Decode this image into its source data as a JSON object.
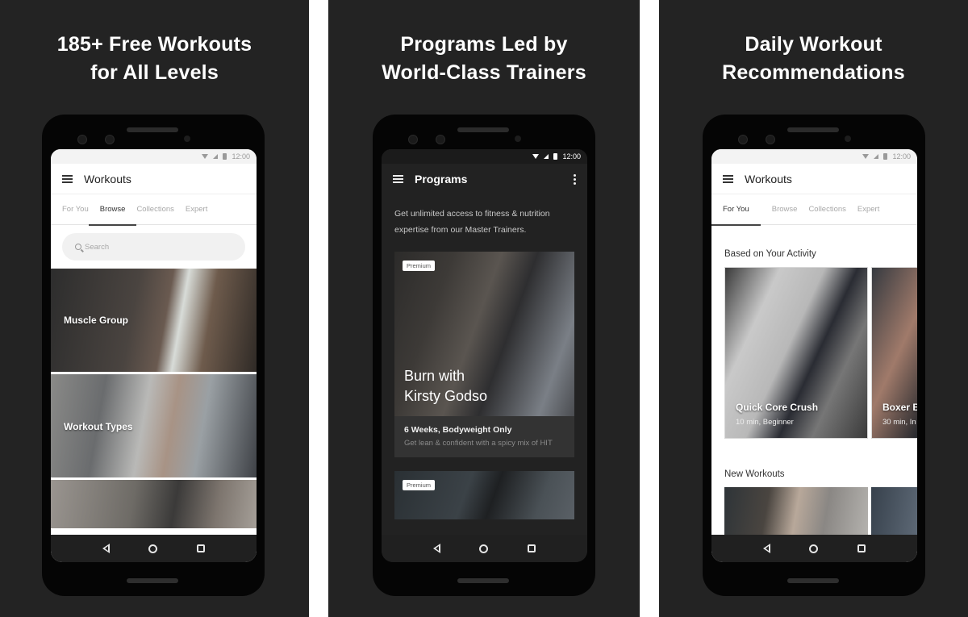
{
  "panels": [
    {
      "headline": [
        "185+ Free Workouts",
        "for All Levels"
      ],
      "status_time": "12:00",
      "appbar_title": "Workouts",
      "tabs": [
        "For You",
        "Browse",
        "Collections",
        "Expert"
      ],
      "active_tab": "Browse",
      "search_placeholder": "Search",
      "categories": [
        "Muscle Group",
        "Workout Types",
        ""
      ]
    },
    {
      "headline": [
        "Programs Led by",
        "World-Class Trainers"
      ],
      "status_time": "12:00",
      "appbar_title": "Programs",
      "intro": "Get unlimited access to fitness & nutrition expertise from our Master Trainers.",
      "programs": [
        {
          "badge": "Premium",
          "title": [
            "Burn with",
            "Kirsty Godso"
          ],
          "subtitle": "6 Weeks, Bodyweight Only",
          "description": "Get lean & confident with a spicy mix of HIT"
        },
        {
          "badge": "Premium"
        }
      ]
    },
    {
      "headline": [
        "Daily Workout",
        "Recommendations"
      ],
      "status_time": "12:00",
      "appbar_title": "Workouts",
      "tabs": [
        "For You",
        "Browse",
        "Collections",
        "Expert"
      ],
      "active_tab": "For You",
      "sections": [
        {
          "title": "Based on Your Activity",
          "cards": [
            {
              "name": "Quick Core Crush",
              "meta": "10 min, Beginner"
            },
            {
              "name": "Boxer B",
              "meta": "30 min, In"
            }
          ]
        },
        {
          "title": "New Workouts"
        }
      ]
    }
  ],
  "icons": {
    "menu": "hamburger-icon",
    "more": "overflow-menu-icon",
    "search": "search-icon",
    "back": "nav-back-icon",
    "home": "nav-home-icon",
    "recents": "nav-recents-icon"
  },
  "colors": {
    "panel_bg": "#232323",
    "phone_body": "#050505",
    "dark_screen": "#222222",
    "light_screen": "#ffffff",
    "tab_active": "#333333",
    "tab_inactive": "#a8a8a8"
  }
}
